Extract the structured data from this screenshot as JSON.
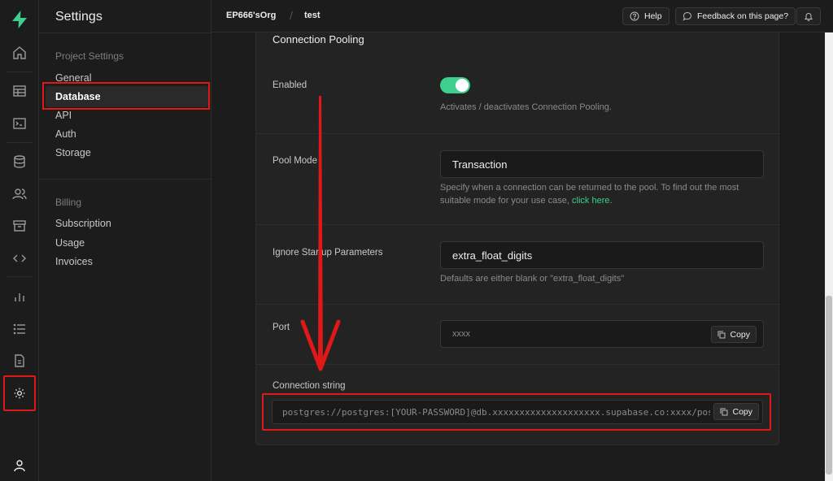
{
  "header": {
    "org": "EP666'sOrg",
    "separator": "/",
    "project": "test",
    "help_label": "Help",
    "feedback_label": "Feedback on this page?"
  },
  "menu": {
    "title": "Settings",
    "project_section": "Project Settings",
    "project_items": [
      "General",
      "Database",
      "API",
      "Auth",
      "Storage"
    ],
    "billing_section": "Billing",
    "billing_items": [
      "Subscription",
      "Usage",
      "Invoices"
    ],
    "active_item": "Database"
  },
  "rail": {
    "icons": [
      "supabase-logo-icon",
      "home-icon",
      "table-editor-icon",
      "sql-editor-icon",
      "database-icon",
      "users-icon",
      "storage-icon",
      "api-icon",
      "reports-icon",
      "logs-icon",
      "docs-icon",
      "settings-icon",
      "account-icon"
    ]
  },
  "pooling": {
    "title": "Connection Pooling",
    "enabled_label": "Enabled",
    "enabled": true,
    "enabled_help": "Activates / deactivates Connection Pooling.",
    "pool_mode_label": "Pool Mode",
    "pool_mode_value": "Transaction",
    "pool_mode_help": "Specify when a connection can be returned to the pool. To find out the most suitable mode for your use case,",
    "pool_mode_link": "click here.",
    "ignore_label": "Ignore Startup Parameters",
    "ignore_value": "extra_float_digits",
    "ignore_help": "Defaults are either blank or \"extra_float_digits\"",
    "port_label": "Port",
    "port_value": "xxxx",
    "copy_label": "Copy",
    "conn_label": "Connection string",
    "conn_value": "postgres://postgres:[YOUR-PASSWORD]@db.xxxxxxxxxxxxxxxxxxxx.supabase.co:xxxx/postgres"
  },
  "colors": {
    "accent": "#3ecf8e",
    "annotation": "#e01818",
    "background": "#1c1c1c"
  }
}
